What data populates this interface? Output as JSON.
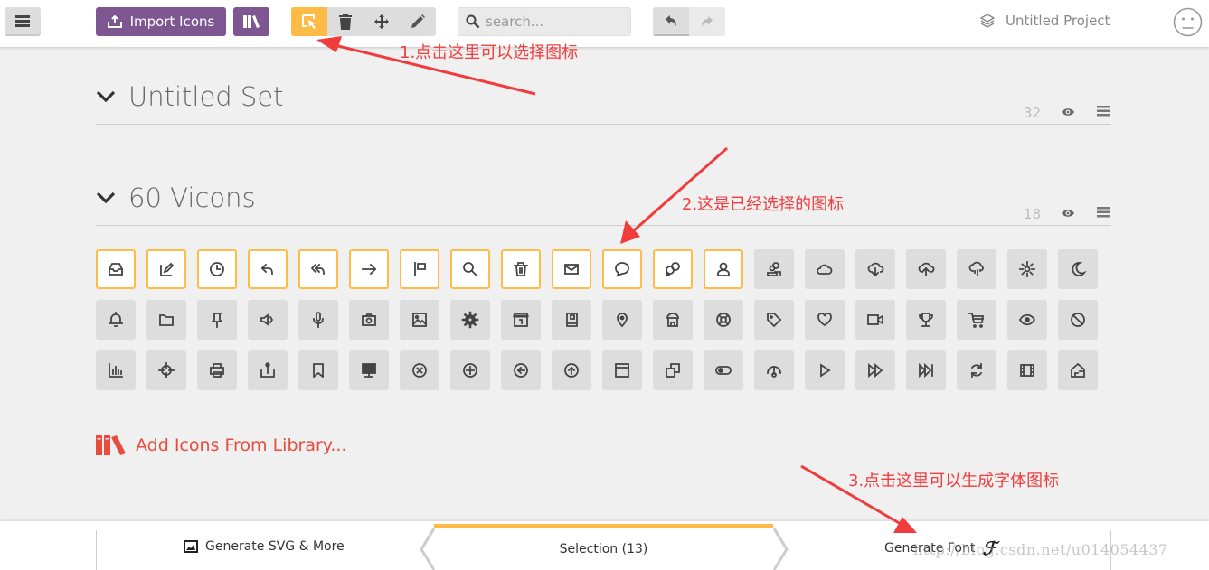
{
  "topbar": {
    "menu_icon": "hamburger-icon",
    "import_label": "Import Icons",
    "import_icon": "upload-icon",
    "library_icon": "library-books-icon",
    "tools": [
      {
        "name": "select",
        "icon": "select-cursor-icon",
        "active": true
      },
      {
        "name": "delete",
        "icon": "trash-icon",
        "active": false
      },
      {
        "name": "move",
        "icon": "move-arrows-icon",
        "active": false
      },
      {
        "name": "edit",
        "icon": "pencil-icon",
        "active": false
      }
    ],
    "search_placeholder": "search...",
    "search_value": "",
    "undo_icon": "undo-icon",
    "redo_icon": "redo-icon",
    "project_name": "Untitled Project",
    "project_icon": "layers-icon",
    "avatar_icon": "neutral-face-icon"
  },
  "sets": [
    {
      "title": "Untitled Set",
      "count": "32",
      "expanded": true
    },
    {
      "title": "60 Vicons",
      "count": "18",
      "expanded": true
    }
  ],
  "icons": [
    {
      "name": "inbox",
      "selected": true
    },
    {
      "name": "edit",
      "selected": true
    },
    {
      "name": "clock",
      "selected": true
    },
    {
      "name": "reply",
      "selected": true
    },
    {
      "name": "reply-all",
      "selected": true
    },
    {
      "name": "arrow-right",
      "selected": true
    },
    {
      "name": "flag",
      "selected": true
    },
    {
      "name": "search",
      "selected": true
    },
    {
      "name": "trash",
      "selected": true
    },
    {
      "name": "mail",
      "selected": true
    },
    {
      "name": "chat",
      "selected": true
    },
    {
      "name": "chats",
      "selected": true
    },
    {
      "name": "user",
      "selected": true
    },
    {
      "name": "users",
      "selected": false
    },
    {
      "name": "cloud",
      "selected": false
    },
    {
      "name": "cloud-download",
      "selected": false
    },
    {
      "name": "cloud-upload",
      "selected": false
    },
    {
      "name": "cloud-rain",
      "selected": false
    },
    {
      "name": "sun",
      "selected": false
    },
    {
      "name": "moon",
      "selected": false
    },
    {
      "name": "bell",
      "selected": false
    },
    {
      "name": "folder",
      "selected": false
    },
    {
      "name": "pin",
      "selected": false
    },
    {
      "name": "volume",
      "selected": false
    },
    {
      "name": "microphone",
      "selected": false
    },
    {
      "name": "camera",
      "selected": false
    },
    {
      "name": "image",
      "selected": false
    },
    {
      "name": "gear",
      "selected": false
    },
    {
      "name": "calendar",
      "selected": false
    },
    {
      "name": "book",
      "selected": false
    },
    {
      "name": "location",
      "selected": false
    },
    {
      "name": "shop",
      "selected": false
    },
    {
      "name": "lifebuoy",
      "selected": false
    },
    {
      "name": "tag",
      "selected": false
    },
    {
      "name": "heart",
      "selected": false
    },
    {
      "name": "video",
      "selected": false
    },
    {
      "name": "trophy",
      "selected": false
    },
    {
      "name": "cart",
      "selected": false
    },
    {
      "name": "eye",
      "selected": false
    },
    {
      "name": "block",
      "selected": false
    },
    {
      "name": "bar-chart",
      "selected": false
    },
    {
      "name": "target",
      "selected": false
    },
    {
      "name": "printer",
      "selected": false
    },
    {
      "name": "share",
      "selected": false
    },
    {
      "name": "bookmark",
      "selected": false
    },
    {
      "name": "monitor",
      "selected": false
    },
    {
      "name": "close-circle",
      "selected": false
    },
    {
      "name": "plus-circle",
      "selected": false
    },
    {
      "name": "arrow-left-circle",
      "selected": false
    },
    {
      "name": "arrow-up-circle",
      "selected": false
    },
    {
      "name": "browser-window",
      "selected": false
    },
    {
      "name": "copy",
      "selected": false
    },
    {
      "name": "toggle",
      "selected": false
    },
    {
      "name": "gauge",
      "selected": false
    },
    {
      "name": "play",
      "selected": false
    },
    {
      "name": "fast-forward",
      "selected": false
    },
    {
      "name": "skip-forward",
      "selected": false
    },
    {
      "name": "refresh",
      "selected": false
    },
    {
      "name": "film",
      "selected": false
    },
    {
      "name": "home",
      "selected": false
    }
  ],
  "add_library_label": "Add Icons From Library...",
  "bottombar": {
    "generate_svg_label": "Generate SVG & More",
    "selection_label": "Selection (13)",
    "generate_font_label": "Generate Font",
    "font_glyph": "ℱ",
    "watermark": "http://blog.csdn.net/u014054437"
  },
  "annotations": [
    "1.点击这里可以选择图标",
    "2.这是已经选择的图标",
    "3.点击这里可以生成字体图标"
  ],
  "colors": {
    "accent_orange": "#ffbb45",
    "brand_purple": "#7e5691",
    "library_red": "#e74c3c",
    "annotation_red": "#f03c3c"
  }
}
